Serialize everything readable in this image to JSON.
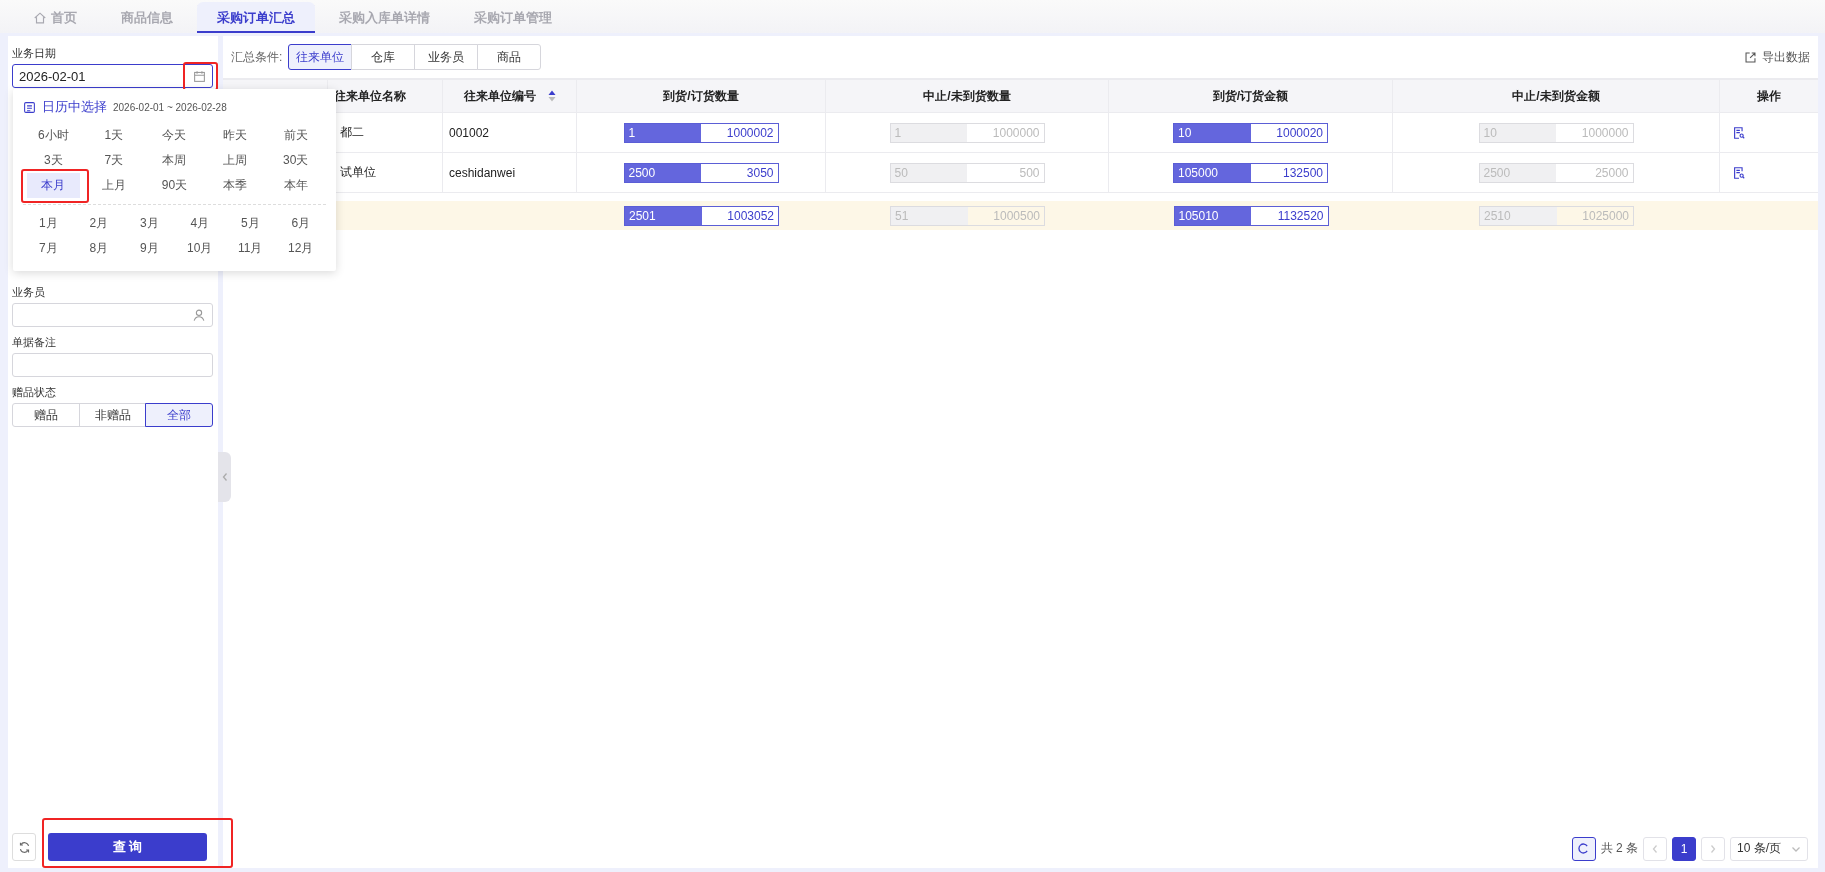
{
  "tabs": [
    {
      "label": "首页",
      "selected": false
    },
    {
      "label": "商品信息",
      "selected": false
    },
    {
      "label": "采购订单汇总",
      "selected": true
    },
    {
      "label": "采购入库单详情",
      "selected": false
    },
    {
      "label": "采购订单管理",
      "selected": false
    }
  ],
  "filters": {
    "date": {
      "label": "业务日期",
      "value": "2026-02-01",
      "highlight": true
    },
    "salesman": {
      "label": "业务员"
    },
    "remark": {
      "label": "单据备注"
    },
    "gift": {
      "label": "赠品状态",
      "options": [
        {
          "label": "赠品",
          "selected": false
        },
        {
          "label": "非赠品",
          "selected": false
        },
        {
          "label": "全部",
          "selected": true
        }
      ]
    }
  },
  "query_button": {
    "label": "查 询",
    "highlight": true
  },
  "date_popup": {
    "title": "日历中选择",
    "range": "2026-02-01 ~ 2026-02-28",
    "quick": [
      {
        "label": "6小时",
        "selected": false,
        "highlight": false
      },
      {
        "label": "1天",
        "selected": false,
        "highlight": false
      },
      {
        "label": "今天",
        "selected": false,
        "highlight": false
      },
      {
        "label": "昨天",
        "selected": false,
        "highlight": false
      },
      {
        "label": "前天",
        "selected": false,
        "highlight": false
      },
      {
        "label": "3天",
        "selected": false,
        "highlight": false
      },
      {
        "label": "7天",
        "selected": false,
        "highlight": false
      },
      {
        "label": "本周",
        "selected": false,
        "highlight": false
      },
      {
        "label": "上周",
        "selected": false,
        "highlight": false
      },
      {
        "label": "30天",
        "selected": false,
        "highlight": false
      },
      {
        "label": "本月",
        "selected": true,
        "highlight": true
      },
      {
        "label": "上月",
        "selected": false,
        "highlight": false
      },
      {
        "label": "90天",
        "selected": false,
        "highlight": false
      },
      {
        "label": "本季",
        "selected": false,
        "highlight": false
      },
      {
        "label": "本年",
        "selected": false,
        "highlight": false
      }
    ],
    "months": [
      "1月",
      "2月",
      "3月",
      "4月",
      "5月",
      "6月",
      "7月",
      "8月",
      "9月",
      "10月",
      "11月",
      "12月"
    ]
  },
  "group_by": {
    "label": "汇总条件:",
    "options": [
      {
        "label": "往来单位",
        "selected": true
      },
      {
        "label": "仓库",
        "selected": false
      },
      {
        "label": "业务员",
        "selected": false
      },
      {
        "label": "商品",
        "selected": false
      }
    ]
  },
  "export": "导出数据",
  "table": {
    "columns": [
      {
        "label": "往来单位名称"
      },
      {
        "label": "往来单位编号",
        "sorted_ascending": true
      },
      {
        "label": "到货/订货数量"
      },
      {
        "label": "中止/未到货数量"
      },
      {
        "label": "到货/订货金额"
      },
      {
        "label": "中止/未到货金额"
      },
      {
        "label": "操作"
      }
    ],
    "rows": [
      {
        "name": "都二",
        "code": "001002",
        "qty": {
          "value": "1",
          "total": "1000002",
          "level": 0.5
        },
        "stop_qty": {
          "value": "1",
          "total": "1000000",
          "level": 0.5
        },
        "amount": {
          "value": "10",
          "total": "1000020",
          "level": 0.5
        },
        "stop_amount": {
          "value": "10",
          "total": "1000000",
          "level": 0.5
        }
      },
      {
        "name": "试单位",
        "code": "ceshidanwei",
        "qty": {
          "value": "2500",
          "total": "3050",
          "level": 0.5
        },
        "stop_qty": {
          "value": "50",
          "total": "500",
          "level": 0.5
        },
        "amount": {
          "value": "105000",
          "total": "132500",
          "level": 0.5
        },
        "stop_amount": {
          "value": "2500",
          "total": "25000",
          "level": 0.5
        }
      }
    ],
    "total": {
      "qty": {
        "value": "2501",
        "total": "1003052",
        "level": 0.5
      },
      "stop_qty": {
        "value": "51",
        "total": "1000500",
        "level": 0.5
      },
      "amount": {
        "value": "105010",
        "total": "1132520",
        "level": 0.5
      },
      "stop_amount": {
        "value": "2510",
        "total": "1025000",
        "level": 0.5
      }
    }
  },
  "pagination": {
    "total": "共 2 条",
    "pages": [
      {
        "label": "1",
        "selected": true
      }
    ],
    "page_size": "10 条/页"
  }
}
